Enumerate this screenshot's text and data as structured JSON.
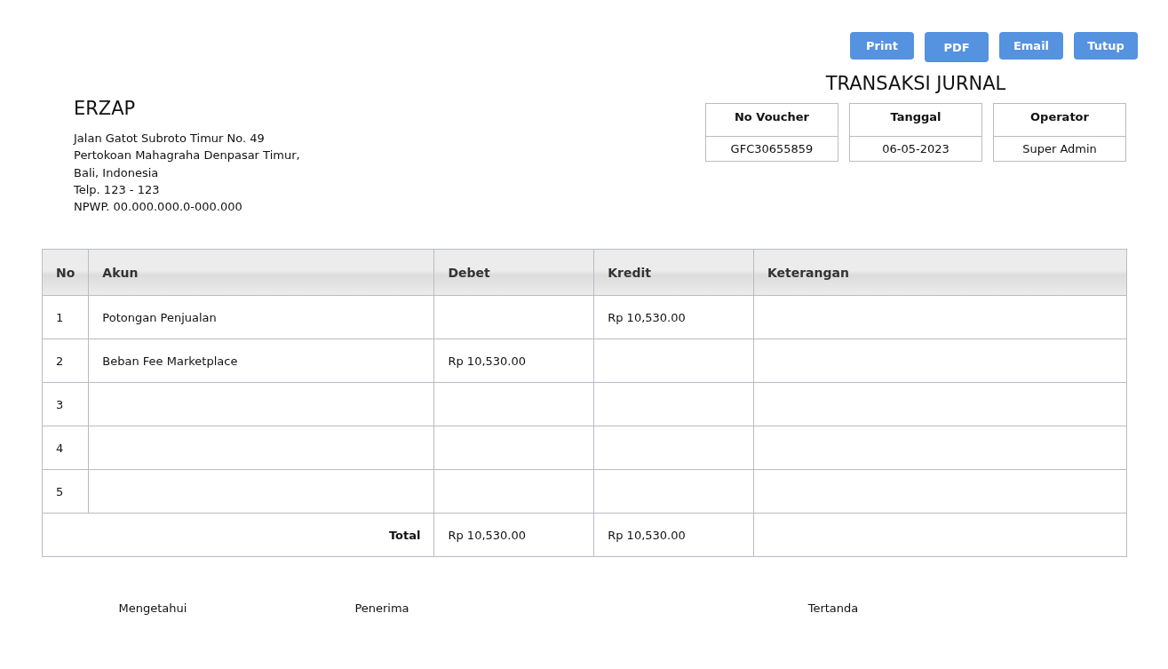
{
  "buttons": [
    "Print",
    "PDF",
    "Email",
    "Tutup"
  ],
  "document_title": "TRANSAKSI JURNAL",
  "company": {
    "name": "ERZAP",
    "address_lines": [
      "Jalan Gatot Subroto Timur No. 49",
      "Pertokoan Mahagraha Denpasar Timur,",
      "Bali, Indonesia",
      "Telp. 123 - 123",
      "NPWP. 00.000.000.0-000.000"
    ]
  },
  "info_boxes": [
    {
      "label": "No Voucher",
      "value": "GFC30655859"
    },
    {
      "label": "Tanggal",
      "value": "06-05-2023"
    },
    {
      "label": "Operator",
      "value": "Super Admin"
    }
  ],
  "table": {
    "columns": [
      "No",
      "Akun",
      "Debet",
      "Kredit",
      "Keterangan"
    ],
    "rows": [
      {
        "no": "1",
        "akun": "Potongan Penjualan",
        "kredit": "Rp 10,530.00"
      },
      {
        "no": "2",
        "akun": "Beban Fee Marketplace",
        "debet": "Rp 10,530.00"
      },
      {
        "no": "3"
      },
      {
        "no": "4"
      },
      {
        "no": "5"
      }
    ],
    "total": {
      "label": "Total",
      "debet": "Rp 10,530.00",
      "kredit": "Rp 10,530.00"
    }
  },
  "signatures": [
    "Mengetahui",
    "Penerima",
    "Tertanda"
  ]
}
